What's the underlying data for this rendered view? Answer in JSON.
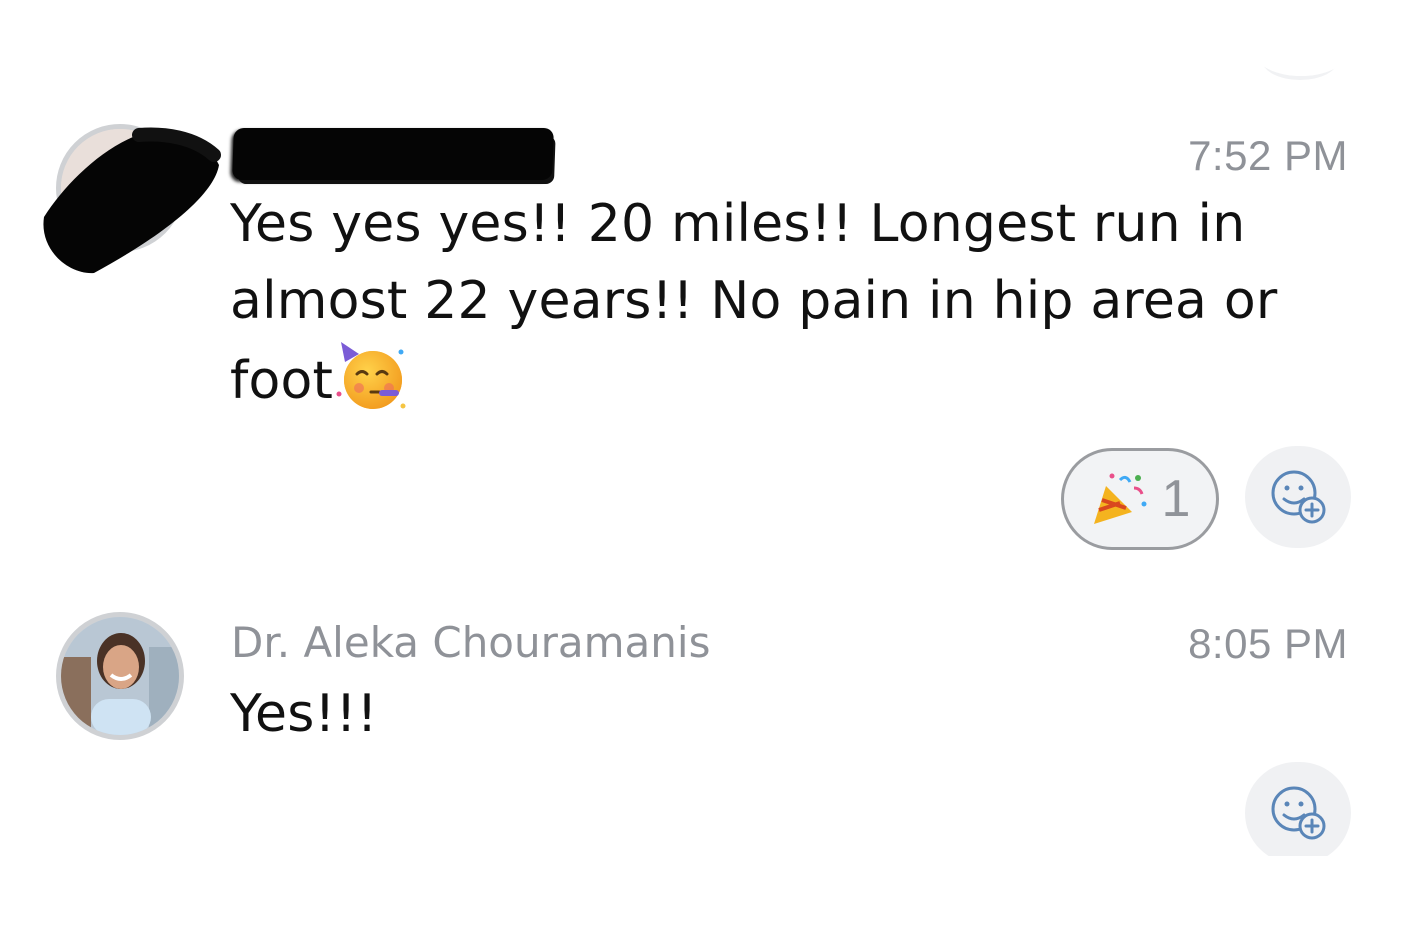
{
  "messages": [
    {
      "sender": "",
      "time": "7:52 PM",
      "text": "Yes yes yes!! 20 miles!! Longest run in almost 22 years!! No pain in hip area or foot",
      "inline_emoji": "partying-face",
      "reactions": [
        {
          "emoji": "party-popper",
          "count": "1"
        }
      ]
    },
    {
      "sender": "Dr. Aleka Chouramanis",
      "time": "8:05 PM",
      "text": "Yes!!!",
      "reactions": []
    }
  ],
  "icons": {
    "add_reaction": "add-reaction-icon",
    "avatar_redaction": "redaction"
  },
  "colors": {
    "timestamp": "#8f9298",
    "text": "#111111",
    "pill_border": "#9a9ca0",
    "icon_blue": "#5a86b8"
  }
}
